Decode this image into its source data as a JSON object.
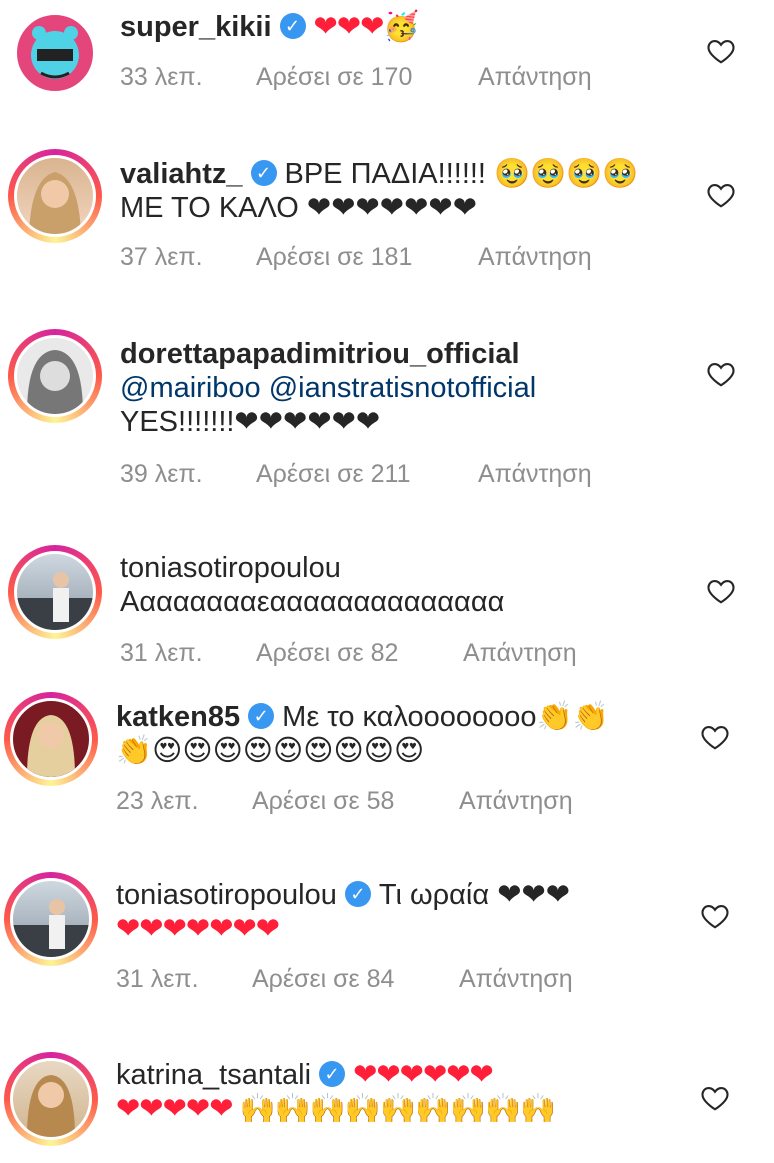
{
  "comments": [
    {
      "user": "super_kikii",
      "verified": true,
      "text": "❤❤❤🥳",
      "time": "33 λεπ.",
      "likes": "Αρέσει σε 170",
      "reply": "Απάντηση"
    },
    {
      "user": "valiahtz_",
      "verified": true,
      "text": "ΒΡΕ ΠΑΔΙΑ!!!!!! 🥹🥹🥹🥹",
      "text2": "ΜΕ ΤΟ ΚΑΛΟ ❤❤❤❤❤❤❤",
      "time": "37 λεπ.",
      "likes": "Αρέσει σε 181",
      "reply": "Απάντηση"
    },
    {
      "user": "dorettapapadimitriou_official",
      "verified": false,
      "mentions": "@mairiboo @ianstratisnotofficial",
      "text2": "YES!!!!!!!❤❤❤❤❤❤",
      "time": "39 λεπ.",
      "likes": "Αρέσει σε 211",
      "reply": "Απάντηση"
    },
    {
      "user": "toniasotiropoulou",
      "verified": false,
      "text2": "Ααααααααεαααααααααααααα",
      "time": "31 λεπ.",
      "likes": "Αρέσει σε 82",
      "reply": "Απάντηση"
    },
    {
      "user": "katken85",
      "verified": true,
      "text": "Με το καλοοοοοοοο👏👏",
      "text2": "👏😍😍😍😍😍😍😍😍😍",
      "time": "23 λεπ.",
      "likes": "Αρέσει σε 58",
      "reply": "Απάντηση"
    },
    {
      "user": "toniasotiropoulou",
      "verified": true,
      "text": "Τι ωραία ❤❤❤",
      "text2": "❤❤❤❤❤❤❤",
      "time": "31 λεπ.",
      "likes": "Αρέσει σε 84",
      "reply": "Απάντηση"
    },
    {
      "user": "katrina_tsantali",
      "verified": true,
      "text": "❤❤❤❤❤❤",
      "text2": "❤❤❤❤❤ 🙌🙌🙌🙌🙌🙌🙌🙌🙌",
      "time": "",
      "likes": "",
      "reply": ""
    }
  ],
  "colors": {
    "accent": "#3897f0",
    "meta": "#8e8e8e",
    "mention": "#00376b",
    "heart": "#ff1f38"
  },
  "icons": {
    "verified": "verified-badge-icon",
    "like": "heart-outline-icon"
  }
}
